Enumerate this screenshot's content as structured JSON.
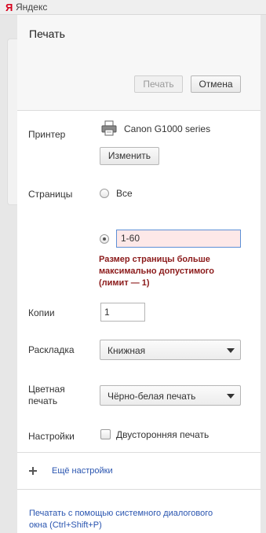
{
  "browser": {
    "logo": "Я",
    "title": "Яндекс"
  },
  "dialog": {
    "title": "Печать",
    "print_button": "Печать",
    "cancel_button": "Отмена"
  },
  "printer": {
    "label": "Принтер",
    "name": "Canon G1000 series",
    "change_button": "Изменить"
  },
  "pages": {
    "label": "Страницы",
    "option_all": "Все",
    "custom_value": "1-60",
    "error": "Размер страницы больше максимально допустимого (лимит — 1)"
  },
  "copies": {
    "label": "Копии",
    "value": "1"
  },
  "layout": {
    "label": "Раскладка",
    "selected": "Книжная"
  },
  "color": {
    "label_line1": "Цветная",
    "label_line2": "печать",
    "selected": "Чёрно-белая печать"
  },
  "settings": {
    "label": "Настройки",
    "duplex": "Двусторонняя печать"
  },
  "more_settings": "Ещё настройки",
  "system_dialog": {
    "line1": "Печатать с помощью системного диалогового",
    "line2": "окна (Ctrl+Shift+P)"
  }
}
